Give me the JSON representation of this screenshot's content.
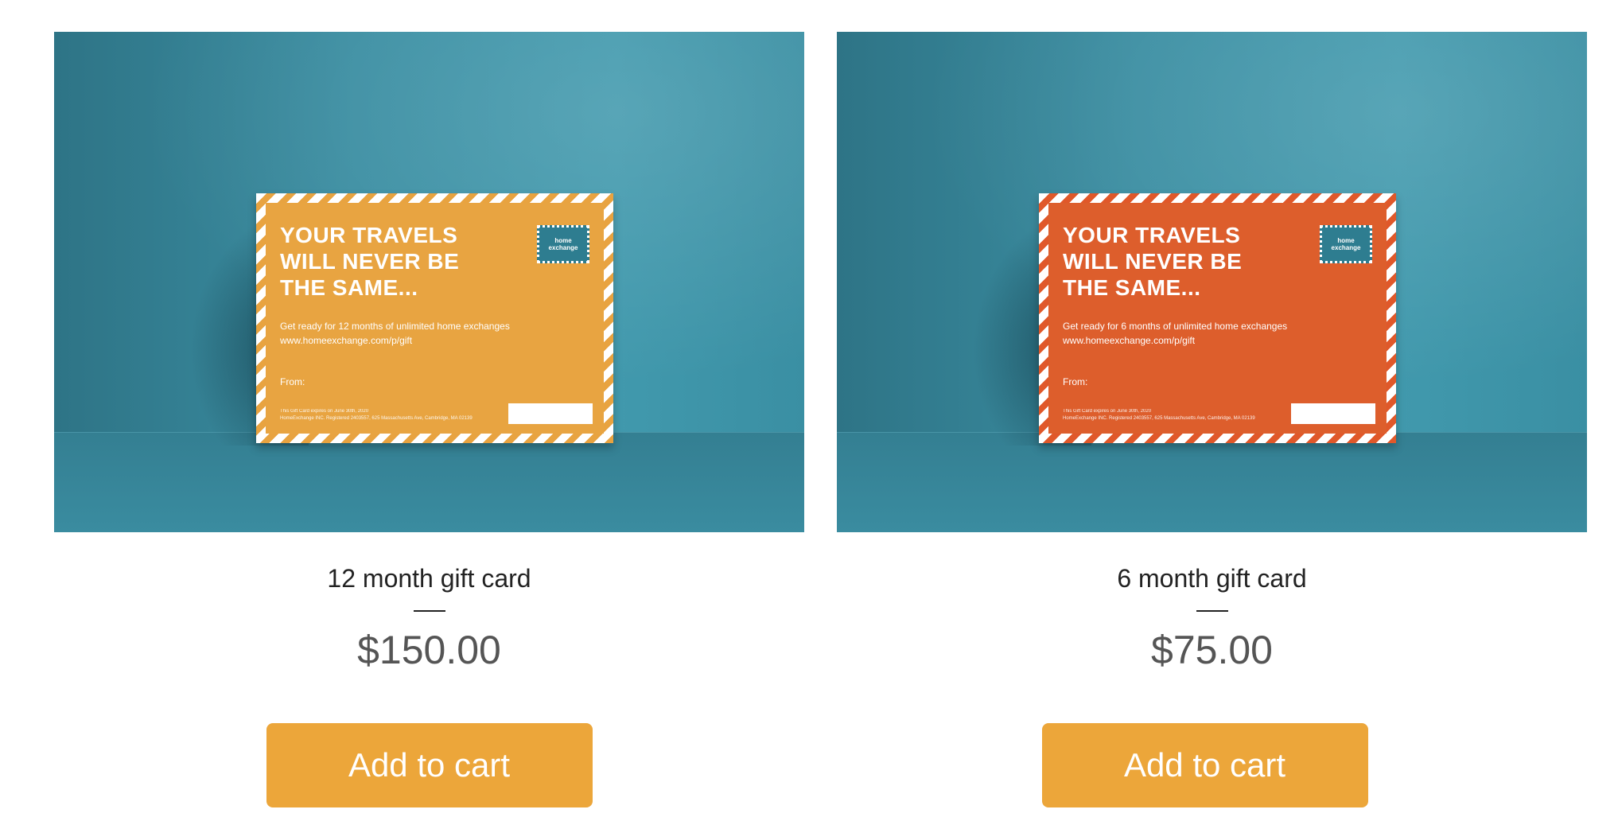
{
  "products": [
    {
      "name": "12 month gift card",
      "price": "$150.00",
      "button_label": "Add to cart",
      "card": {
        "headline": "YOUR TRAVELS WILL NEVER BE THE SAME...",
        "subline": "Get ready for 12 months of unlimited home exchanges",
        "url": "www.homeexchange.com/p/gift",
        "from_label": "From:",
        "fine_print_1": "This Gift Card expires on June 30th, 2020",
        "fine_print_2": "HomeExchange INC. Registered 2403557, 625 Massachusetts Ave, Cambridge, MA 02139",
        "stamp_text": "home exchange",
        "color": "#e8a441"
      }
    },
    {
      "name": "6 month gift card",
      "price": "$75.00",
      "button_label": "Add to cart",
      "card": {
        "headline": "YOUR TRAVELS WILL NEVER BE THE SAME...",
        "subline": "Get ready for 6 months of unlimited home exchanges",
        "url": "www.homeexchange.com/p/gift",
        "from_label": "From:",
        "fine_print_1": "This Gift Card expires on June 30th, 2020",
        "fine_print_2": "HomeExchange INC. Registered 2403557, 625 Massachusetts Ave, Cambridge, MA 02139",
        "stamp_text": "home exchange",
        "color": "#dd5e2c"
      }
    }
  ],
  "colors": {
    "button": "#eca63a",
    "photo_background": "#3a8ea3"
  }
}
